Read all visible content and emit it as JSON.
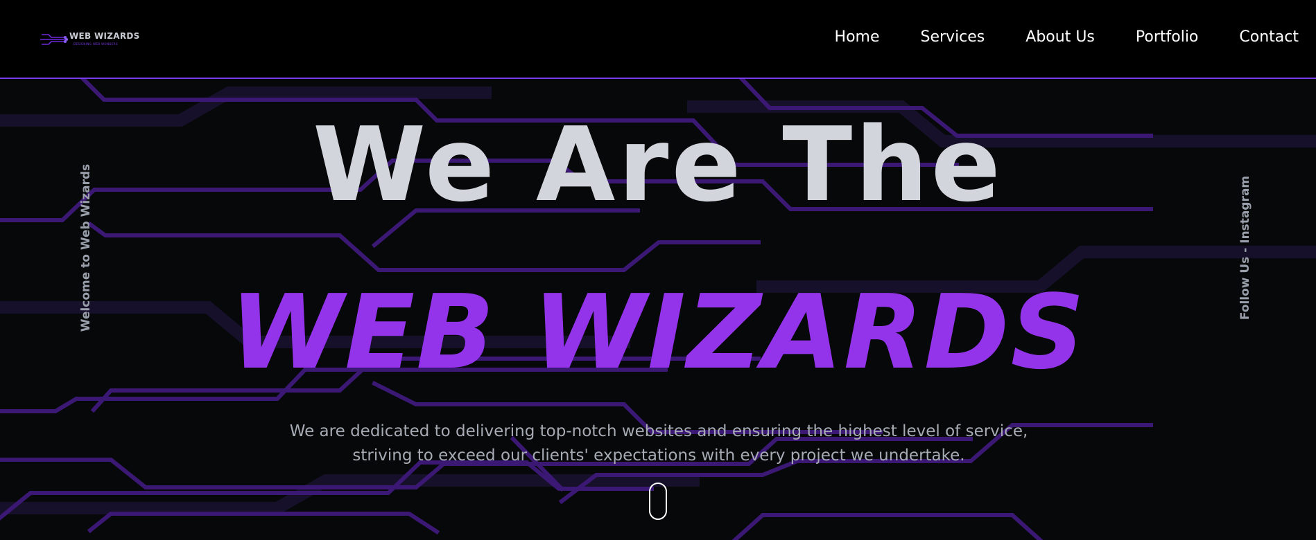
{
  "header": {
    "logo_name": "WEB WIZARDS",
    "logo_tagline": "DESIGNING WEB WONDERS",
    "nav": [
      {
        "label": "Home"
      },
      {
        "label": "Services"
      },
      {
        "label": "About Us"
      },
      {
        "label": "Portfolio"
      },
      {
        "label": "Contact"
      }
    ]
  },
  "hero": {
    "side_left": "Welcome to Web Wizards",
    "side_right": "Follow Us -  Instagram",
    "headline_line1": "We Are The",
    "headline_line2": "WEB WIZARDS",
    "subtext_line1": "We are dedicated to delivering top-notch websites and ensuring the highest level of service,",
    "subtext_line2": "striving to exceed our clients' expectations with every project we undertake.",
    "scroll_icon": "mouse-scroll-icon"
  },
  "colors": {
    "accent": "#9333ea",
    "circuit": "#4c1d95",
    "nav_border": "#7c3aed",
    "headline": "#d2d5dc",
    "subtext": "#a6abb4",
    "background": "#060809"
  }
}
